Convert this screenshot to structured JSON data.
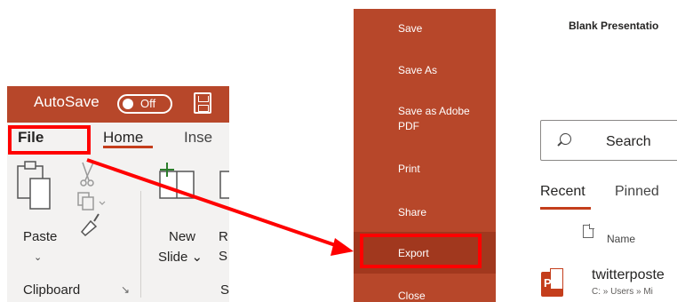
{
  "ribbon": {
    "autosave_label": "AutoSave",
    "autosave_state": "Off",
    "tabs": {
      "file": "File",
      "home": "Home",
      "insert": "Inse"
    },
    "groups": {
      "paste_label": "Paste",
      "paste_arrow": "⌄",
      "new_label": "New",
      "slide_label": "Slide ⌄",
      "r_label": "R",
      "s_label": "S",
      "clipboard_label": "Clipboard",
      "launcher_glyph": "↘",
      "slides_partial": "Sl"
    }
  },
  "backstage": {
    "nav": {
      "save": "Save",
      "save_as": "Save As",
      "save_as_pdf": "Save as Adobe PDF",
      "print": "Print",
      "share": "Share",
      "export": "Export",
      "close": "Close"
    },
    "doc_title": "Blank Presentatio",
    "search_placeholder": "Search",
    "tabs": {
      "recent": "Recent",
      "pinned": "Pinned"
    },
    "list_header": "Name",
    "files": [
      {
        "name": "twitterposte",
        "path": "C: » Users » Mi",
        "icon_letter": "P"
      }
    ]
  },
  "colors": {
    "accent": "#b7472a",
    "accent_dark": "#a1381e",
    "highlight": "#ff0000",
    "tab_underline": "#c43e1c"
  },
  "icons": [
    "save-icon",
    "paste-icon",
    "cut-icon",
    "copy-icon",
    "format-painter-icon",
    "new-slide-icon",
    "search-icon",
    "file-icon",
    "powerpoint-file-icon"
  ]
}
